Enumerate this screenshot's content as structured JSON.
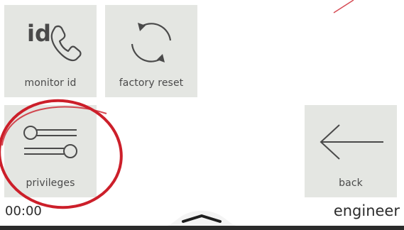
{
  "tiles": {
    "monitor_id": {
      "label": "monitor id",
      "icon": "id-phone-icon",
      "id_text": "id"
    },
    "factory_reset": {
      "label": "factory reset",
      "icon": "circular-arrows-icon"
    },
    "privileges": {
      "label": "privileges",
      "icon": "sliders-icon"
    },
    "back": {
      "label": "back",
      "icon": "arrow-left-icon"
    }
  },
  "status": {
    "time": "00:00",
    "role": "engineer"
  },
  "colors": {
    "tile_bg": "#e4e6e2",
    "icon_stroke": "#4a4a4a",
    "annotation_red": "#cc1f2a"
  }
}
